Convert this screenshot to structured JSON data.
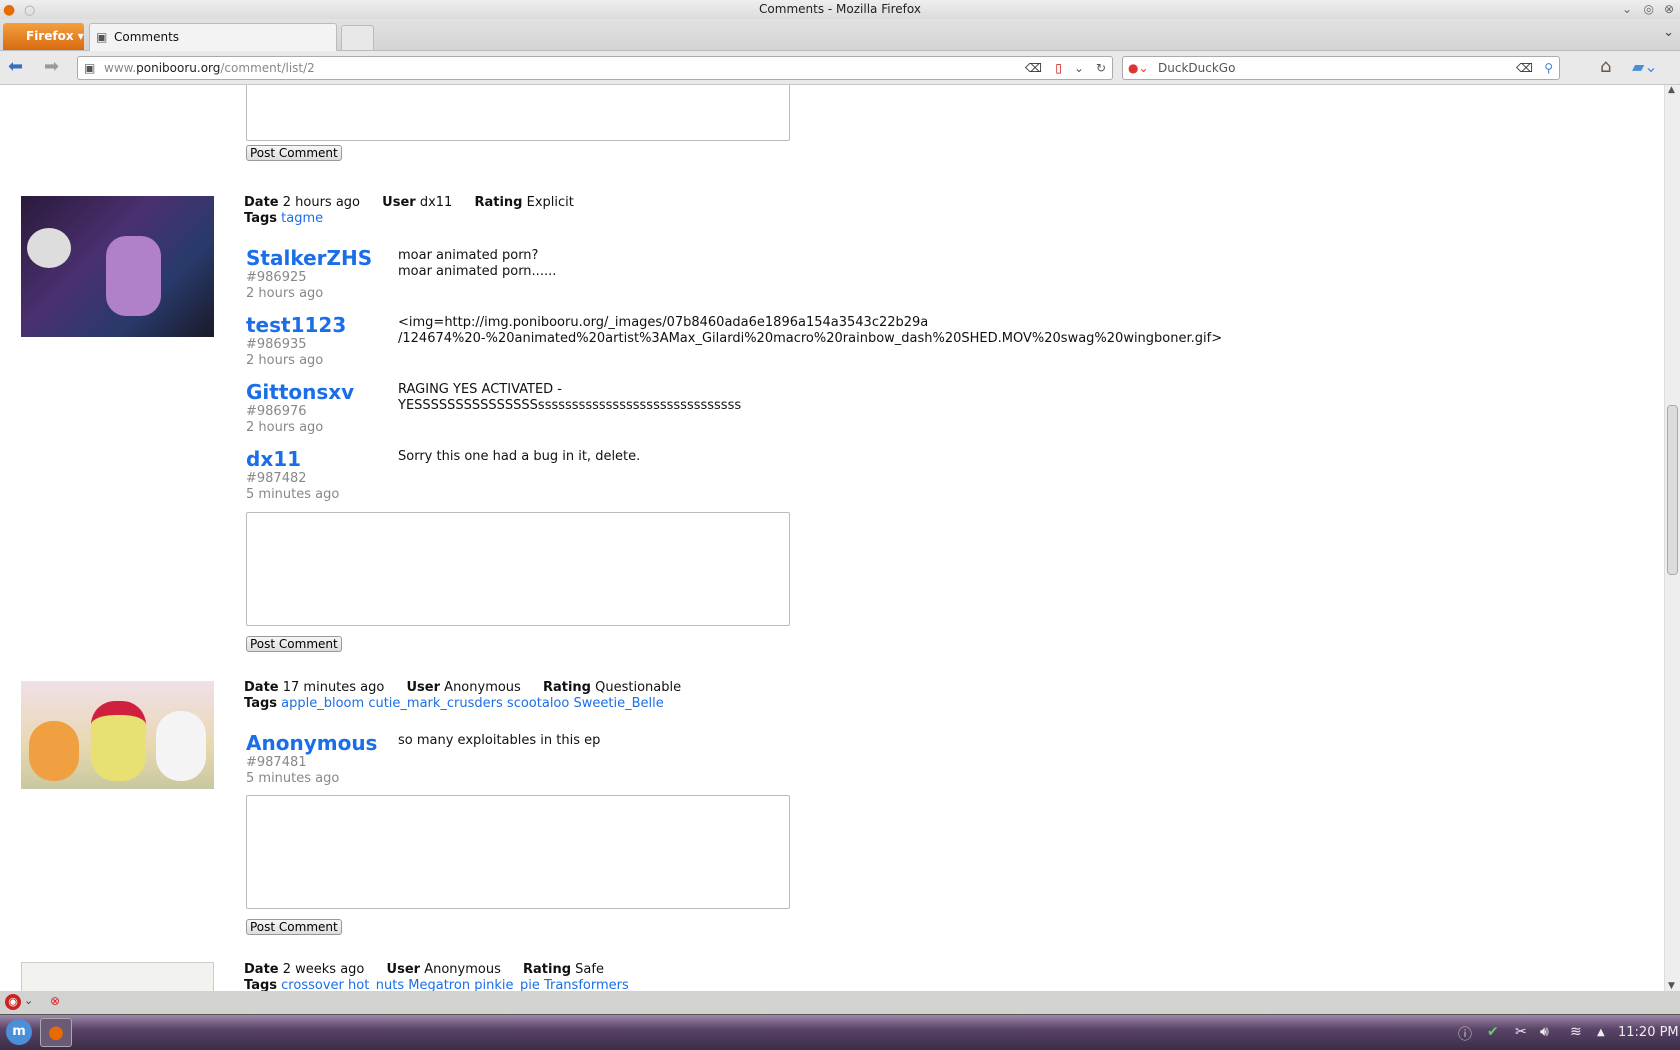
{
  "window": {
    "title": "Comments - Mozilla Firefox"
  },
  "tabs": {
    "firefox_button": "Firefox",
    "active_tab": "Comments"
  },
  "nav": {
    "url_domain_prefix": "www.",
    "url_domain": "ponibooru.org",
    "url_path": "/comment/list/2",
    "search_placeholder": "DuckDuckGo"
  },
  "post_comment_label": "Post Comment",
  "labels": {
    "date": "Date",
    "user": "User",
    "rating": "Rating",
    "tags": "Tags"
  },
  "posts": [
    {
      "date": "2 hours ago",
      "user": "dx11",
      "rating": "Explicit",
      "tags": [
        "tagme"
      ],
      "comments": [
        {
          "user": "StalkerZHS",
          "id": "#986925",
          "time": "2 hours ago",
          "text": "moar animated porn?\nmoar animated porn......"
        },
        {
          "user": "test1123",
          "id": "#986935",
          "time": "2 hours ago",
          "text": "<img=http://img.ponibooru.org/_images/07b8460ada6e1896a154a3543c22b29a\n/124674%20-%20animated%20artist%3AMax_Gilardi%20macro%20rainbow_dash%20SHED.MOV%20swag%20wingboner.gif>"
        },
        {
          "user": "Gittonsxv",
          "id": "#986976",
          "time": "2 hours ago",
          "text": "RAGING YES ACTIVATED -\nYESSSSSSSSSSSSSSSssssssssssssssssssssssssssssss"
        },
        {
          "user": "dx11",
          "id": "#987482",
          "time": "5 minutes ago",
          "text": "Sorry this one had a bug in it, delete."
        }
      ]
    },
    {
      "date": "17 minutes ago",
      "user": "Anonymous",
      "rating": "Questionable",
      "tags": [
        "apple_bloom",
        "cutie_mark_crusders",
        "scootaloo",
        "Sweetie_Belle"
      ],
      "comments": [
        {
          "user": "Anonymous",
          "id": "#987481",
          "time": "5 minutes ago",
          "text": "so many exploitables in this ep"
        }
      ]
    },
    {
      "date": "2 weeks ago",
      "user": "Anonymous",
      "rating": "Safe",
      "tags": [
        "crossover",
        "hot_nuts",
        "Megatron",
        "pinkie_pie",
        "Transformers"
      ],
      "comments": []
    }
  ],
  "taskbar": {
    "clock": "11:20 PM"
  }
}
